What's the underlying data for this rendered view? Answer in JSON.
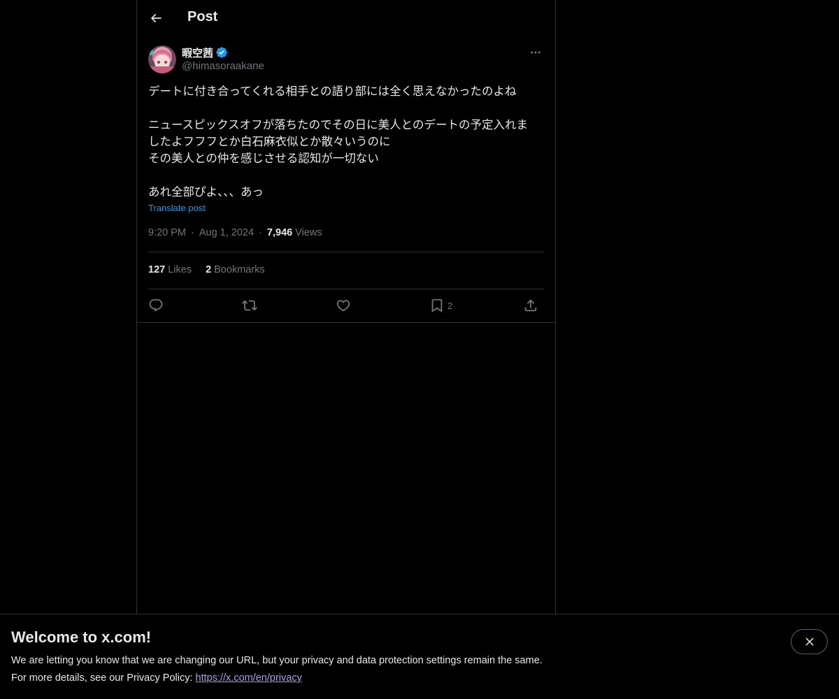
{
  "header": {
    "title": "Post"
  },
  "author": {
    "display_name": "暇空茜",
    "handle": "@himasoraakane",
    "verified": true
  },
  "post": {
    "text": "デートに付き合ってくれる相手との語り部には全く思えなかったのよね\n\nニュースピックスオフが落ちたのでその日に美人とのデートの予定入れま\nしたよフフフとか白石麻衣似とか散々いうのに\nその美人との仲を感じさせる認知が一切ない\n\nあれ全部ぴよ、、、あっ",
    "translate_label": "Translate post",
    "time": "9:20 PM",
    "date": "Aug 1, 2024",
    "views_count": "7,946",
    "views_label": "Views"
  },
  "stats": {
    "likes_count": "127",
    "likes_label": "Likes",
    "bookmarks_count": "2",
    "bookmarks_label": "Bookmarks"
  },
  "actions": {
    "bookmark_count": "2"
  },
  "colors": {
    "accent": "#1d9bf0",
    "muted": "#71767b",
    "border": "#2f3336",
    "link": "#a89ff0"
  },
  "banner": {
    "title": "Welcome to x.com!",
    "line1": "We are letting you know that we are changing our URL, but your privacy and data protection settings remain the same.",
    "line2_prefix": "For more details, see our Privacy Policy: ",
    "line2_link": "https://x.com/en/privacy"
  }
}
